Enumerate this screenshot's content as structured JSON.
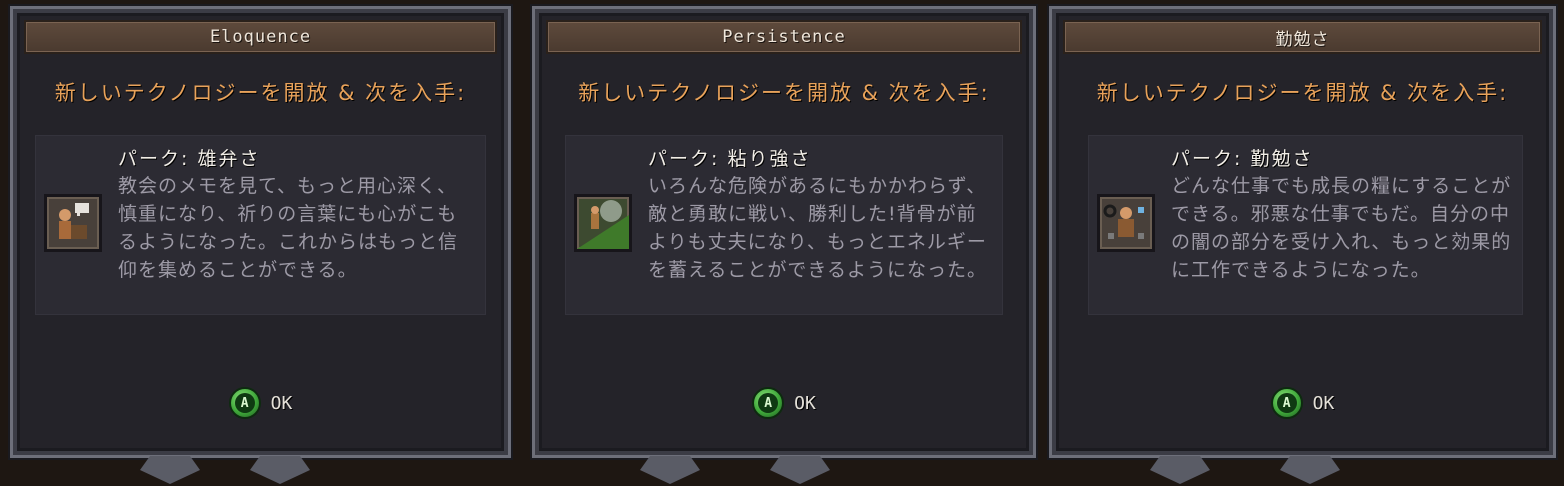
{
  "panels": [
    {
      "title": "Eloquence",
      "intro": "新しいテクノロジーを開放 & 次を入手:",
      "perk_title": "パーク: 雄弁さ",
      "perk_description": "教会のメモを見て、もっと用心深く、慎重になり、祈りの言葉にも心がこもるようになった。これからはもっと信仰を集めることができる。",
      "portrait_icon": "preacher-with-speech-bubble-icon",
      "ok_button_glyph": "A",
      "ok_label": "OK"
    },
    {
      "title": "Persistence",
      "intro": "新しいテクノロジーを開放 & 次を入手:",
      "perk_title": "パーク: 粘り強さ",
      "perk_description": "いろんな危険があるにもかかわらず、敵と勇敢に戦い、勝利した!背骨が前よりも丈夫になり、もっとエネルギーを蓄えることができるようになった。",
      "portrait_icon": "pushing-boulder-icon",
      "ok_button_glyph": "A",
      "ok_label": "OK"
    },
    {
      "title": "勤勉さ",
      "intro": "新しいテクノロジーを開放 & 次を入手:",
      "perk_title": "パーク: 勤勉さ",
      "perk_description": "どんな仕事でも成長の糧にすることができる。邪悪な仕事でもだ。自分の中の闇の部分を受け入れ、もっと効果的に工作できるようになった。",
      "portrait_icon": "worker-with-tools-icon",
      "ok_button_glyph": "A",
      "ok_label": "OK"
    }
  ],
  "colors": {
    "intro_text": "#e8a25a",
    "panel_bg": "#242329",
    "title_bar": "#5e4a3c",
    "ok_button": "#3fa83a"
  }
}
